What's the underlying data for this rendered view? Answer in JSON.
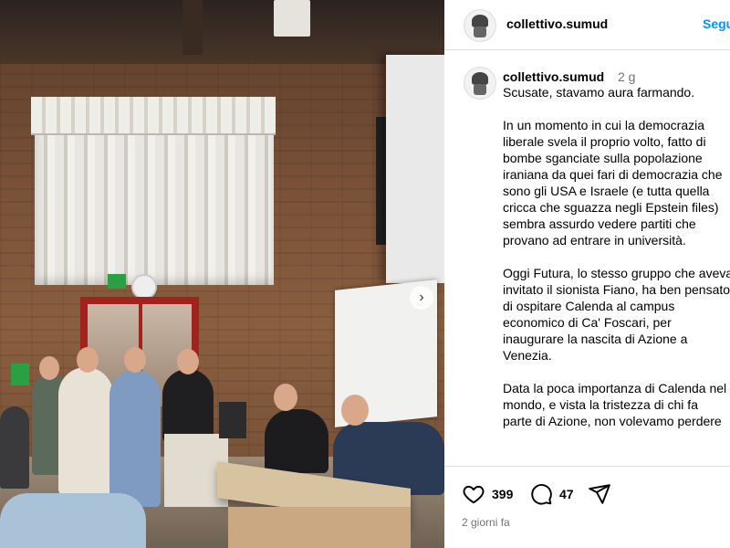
{
  "post": {
    "next_glyph": "›"
  },
  "header": {
    "username": "collettivo.sumud",
    "follow_label": "Segui"
  },
  "caption": {
    "username": "collettivo.sumud",
    "time": "2 g",
    "paragraphs": [
      "Scusate, stavamo aura farmando.",
      "In un momento in cui la democrazia\nliberale svela il proprio volto, fatto di\nbombe sganciate sulla popolazione\niraniana da quei fari di democrazia che\nsono gli USA e Israele (e tutta quella\ncricca che sguazza negli Epstein files)\nsembra assurdo vedere partiti che\nprovano ad entrare in università.",
      "Oggi Futura, lo stesso gruppo che aveva\ninvitato il sionista Fiano, ha ben pensato\ndi ospitare Calenda al campus\neconomico di Ca' Foscari, per\ninaugurare la nascita di Azione a\nVenezia.",
      "Data la poca importanza di Calenda nel\nmondo, e vista la tristezza di chi fa\nparte di Azione, non volevamo perdere"
    ]
  },
  "actions": {
    "likes": "399",
    "comments": "47"
  },
  "footer": {
    "date": "2 giorni fa"
  },
  "icons": {
    "like": "heart-icon",
    "comment": "comment-icon",
    "share": "share-icon",
    "next": "chevron-right-icon"
  }
}
